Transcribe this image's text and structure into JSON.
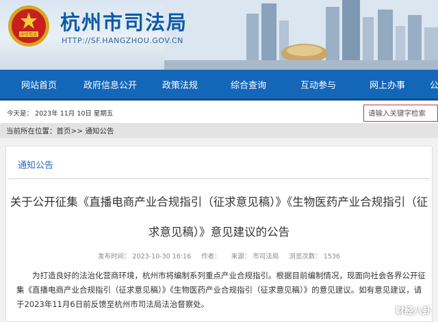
{
  "header": {
    "site_title": "杭州市司法局",
    "site_url": "HTTP://SF.HANGZHOU.GOV.CN",
    "emblem_text": "中华司法",
    "brand_color": "#0d5aa8"
  },
  "nav": {
    "items": [
      "网站首页",
      "政府信息公开",
      "政策法规",
      "综合查询",
      "互动参与",
      "网上办事",
      "公"
    ],
    "color": "#1466b8"
  },
  "datebar": {
    "today": "今天是： 2023年 11月 10日  星期五",
    "search_placeholder": "请输入关键字检索"
  },
  "breadcrumb": {
    "prefix": "当前所在位置：",
    "home": "首页",
    "sep": ">>",
    "current": "通知公告"
  },
  "section": {
    "title": "通知公告"
  },
  "article": {
    "title": "关于公开征集《直播电商产业合规指引（征求意见稿）》《生物医药产业合规指引（征求意见稿）》意见建议的公告",
    "published": "发布时间： 2023-10-30 16:16",
    "source": "作者：",
    "origin": "来源： 市司法局",
    "views": "浏览次数： 1536",
    "body": "为打造良好的法治化营商环境，杭州市将编制系列重点产业合规指引。根据目前编制情况，现面向社会各界公开征集《直播电商产业合规指引（征求意见稿）》《生物医药产业合规指引（征求意见稿）》的意见建议。如有意见建议，请于2023年11月6日前反馈至杭州市司法局法治督察处。"
  },
  "watermark": "财经八卦"
}
